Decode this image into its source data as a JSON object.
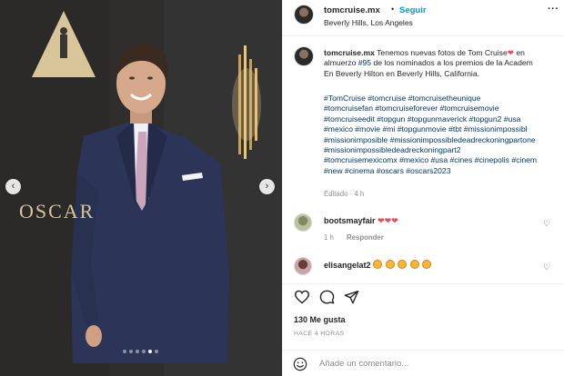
{
  "post": {
    "username": "tomcruise.mx",
    "separator": "•",
    "follow_label": "Seguir",
    "location": "Beverly Hills, Los Angeles",
    "more_label": "···",
    "caption": {
      "line1_pre": "Tenemos nuevas fotos de Tom Cruise",
      "line1_post": " en",
      "line2_pre": "almuerzo ",
      "line2_tag": "#95",
      "line2_post": " de los nominados a los premios de la Academ",
      "line3": "En Beverly Hilton en Beverly Hills, California."
    },
    "heart_emoji": "❤",
    "hashtag_lines": [
      "#TomCruise #tomcruise #tomcruisetheunique",
      "#tomcruisefan #tomcruiseforever #tomcruisemovie",
      "#tomcruiseedit #topgun #topgunmaverick #topgun2 #usa",
      "#mexico #movie #mi #topgunmovie #tbt #missionimpossibl",
      "#missionimposible #missionimpossibledeadreckoningpartone",
      "#missionimpossibledeadreckoningpart2",
      "#tomcruisemexicomx #mexico #usa #cines #cinepolis #cinem",
      "#new #cinema #oscars #oscars2023"
    ],
    "edited_label": "Editado · 4 h",
    "icons": {
      "more": "more-options-icon",
      "like": "heart-icon",
      "comment": "comment-icon",
      "share": "share-icon",
      "emoji": "emoji-smile-icon",
      "prev": "chevron-left-icon",
      "next": "chevron-right-icon"
    }
  },
  "comments": [
    {
      "username": "bootsmayfair",
      "text": "❤❤❤",
      "time": "1 h",
      "reply_label": "Responder"
    },
    {
      "username": "elisangelat2",
      "emoji_count": 5
    }
  ],
  "likes": "130 Me gusta",
  "timestamp": "HACE 4 HORAS",
  "comment_input": {
    "placeholder": "Añade un comentario..."
  },
  "carousel": {
    "total": 6,
    "active_index": 4
  },
  "photo": {
    "sign_text": "OSCAR"
  },
  "colors": {
    "link_blue": "#0095f6",
    "hashtag": "#00376b",
    "heart_red": "#ed4956",
    "muted": "#8e8e8e",
    "suit": "#2c3558",
    "tie": "#c9a6bd"
  }
}
